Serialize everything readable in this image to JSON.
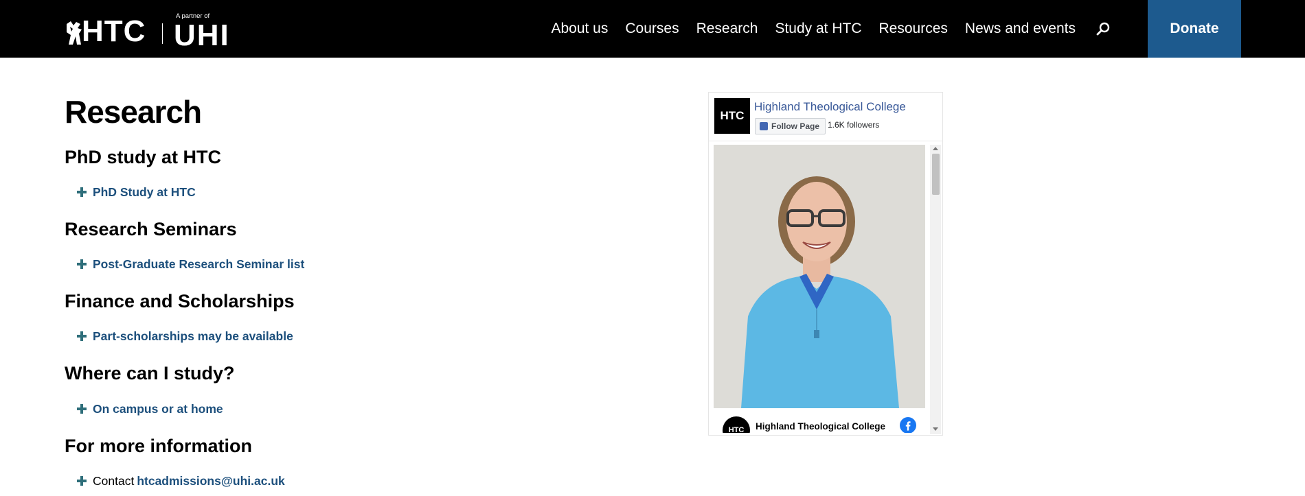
{
  "header": {
    "logo": {
      "primary": "HTC",
      "partner_text": "A partner of",
      "partner": "UHI"
    },
    "nav": [
      "About us",
      "Courses",
      "Research",
      "Study at HTC",
      "Resources",
      "News and events"
    ],
    "donate_label": "Donate"
  },
  "main": {
    "title": "Research",
    "sections": [
      {
        "heading": "PhD study at HTC",
        "link": "PhD Study at HTC"
      },
      {
        "heading": "Research Seminars",
        "link": "Post-Graduate Research Seminar list"
      },
      {
        "heading": "Finance and Scholarships",
        "link": "Part-scholarships may be available"
      },
      {
        "heading": "Where can I study?",
        "link": "On campus or at home"
      },
      {
        "heading": "For more information",
        "prefix": "Contact",
        "link": "htcadmissions@uhi.ac.uk"
      }
    ]
  },
  "facebook": {
    "page_name": "Highland Theological College",
    "follow_label": "Follow Page",
    "followers": "1.6K followers",
    "avatar_text": "HTC",
    "post_author": "Highland Theological College"
  },
  "colors": {
    "header_bg": "#000000",
    "donate_bg": "#1d5a8e",
    "link": "#1c4f7c",
    "plus": "#2e6e7a",
    "fb_link": "#385898"
  },
  "icons": [
    "search-icon",
    "plus-icon",
    "facebook-icon",
    "scroll-up-icon",
    "scroll-down-icon"
  ]
}
